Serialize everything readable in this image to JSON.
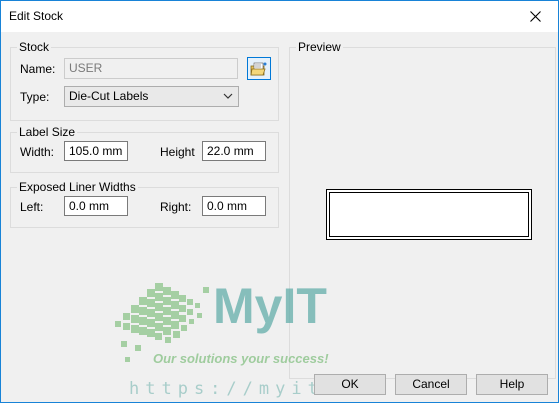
{
  "window": {
    "title": "Edit Stock",
    "close_icon": "close-icon"
  },
  "stock": {
    "group_title": "Stock",
    "name_label": "Name:",
    "name_value": "USER",
    "type_label": "Type:",
    "type_value": "Die-Cut Labels",
    "browse_icon": "folder-browse-icon"
  },
  "label_size": {
    "group_title": "Label Size",
    "width_label": "Width:",
    "width_value": "105.0 mm",
    "height_label": "Height",
    "height_value": "22.0 mm"
  },
  "liner": {
    "group_title": "Exposed Liner Widths",
    "left_label": "Left:",
    "left_value": "0.0 mm",
    "right_label": "Right:",
    "right_value": "0.0 mm"
  },
  "preview": {
    "group_title": "Preview"
  },
  "buttons": {
    "ok": "OK",
    "cancel": "Cancel",
    "help": "Help"
  },
  "watermark": {
    "brand": "MyIT",
    "tagline": "Our solutions your success!",
    "url": "https://myit.vn",
    "colors": {
      "brand": "#5aa9a6",
      "accent": "#8cc48a"
    }
  }
}
